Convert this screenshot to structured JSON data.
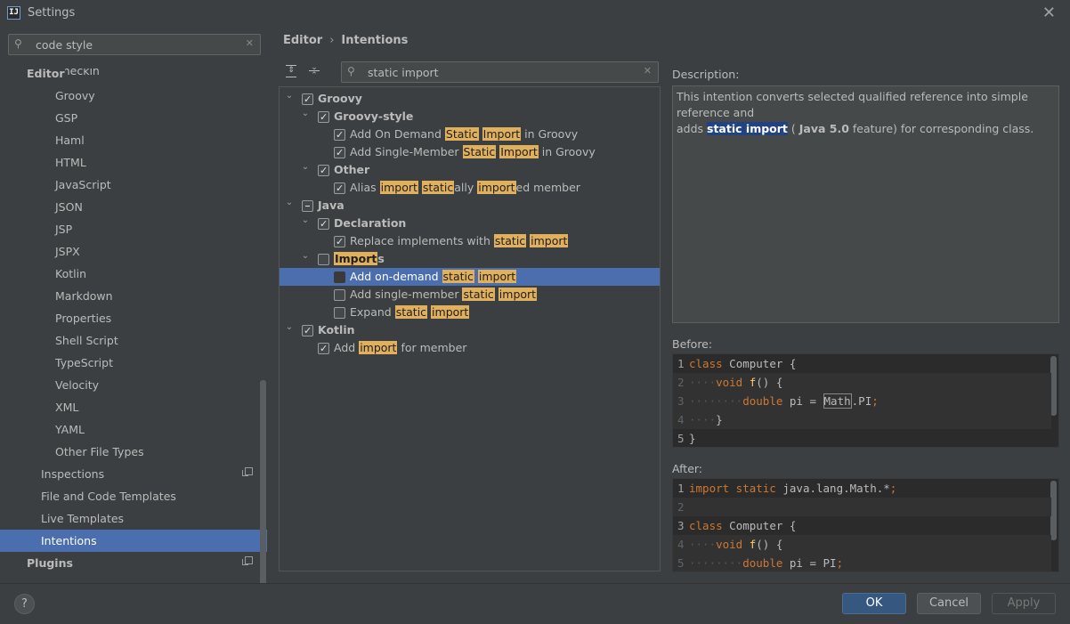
{
  "window": {
    "title": "Settings",
    "icon": "intellij-icon",
    "icon_text": "IJ"
  },
  "sidebar": {
    "search_value": "code style",
    "items": [
      {
        "label": "Editor",
        "bold": true,
        "level": 0
      },
      {
        "label": "Checkin",
        "level": 2,
        "partial": true
      },
      {
        "label": "Groovy",
        "level": 2
      },
      {
        "label": "GSP",
        "level": 2
      },
      {
        "label": "Haml",
        "level": 2
      },
      {
        "label": "HTML",
        "level": 2
      },
      {
        "label": "JavaScript",
        "level": 2
      },
      {
        "label": "JSON",
        "level": 2
      },
      {
        "label": "JSP",
        "level": 2
      },
      {
        "label": "JSPX",
        "level": 2
      },
      {
        "label": "Kotlin",
        "level": 2
      },
      {
        "label": "Markdown",
        "level": 2
      },
      {
        "label": "Properties",
        "level": 2
      },
      {
        "label": "Shell Script",
        "level": 2
      },
      {
        "label": "TypeScript",
        "level": 2
      },
      {
        "label": "Velocity",
        "level": 2
      },
      {
        "label": "XML",
        "level": 2
      },
      {
        "label": "YAML",
        "level": 2
      },
      {
        "label": "Other File Types",
        "level": 2
      },
      {
        "label": "Inspections",
        "level": 1,
        "copy_icon": true
      },
      {
        "label": "File and Code Templates",
        "level": 1
      },
      {
        "label": "Live Templates",
        "level": 1
      },
      {
        "label": "Intentions",
        "level": 1,
        "selected": true
      },
      {
        "label": "Plugins",
        "bold": true,
        "level": 0,
        "copy_icon": true
      }
    ]
  },
  "breadcrumb": {
    "parent": "Editor",
    "separator": "›",
    "current": "Intentions"
  },
  "toolbar": {
    "expand_all": "expand-all-icon",
    "collapse_all": "collapse-all-icon"
  },
  "intentions_search": {
    "value": "static import"
  },
  "tree": [
    {
      "level": 0,
      "arrow": "v",
      "check": "on",
      "bold": true,
      "segments": [
        {
          "t": "Groovy"
        }
      ]
    },
    {
      "level": 1,
      "arrow": "v",
      "check": "on",
      "bold": true,
      "segments": [
        {
          "t": "Groovy-style"
        }
      ]
    },
    {
      "level": 2,
      "check": "on",
      "segments": [
        {
          "t": "Add On Demand "
        },
        {
          "t": "Static",
          "h": true
        },
        {
          "t": " "
        },
        {
          "t": "Import",
          "h": true
        },
        {
          "t": " in Groovy"
        }
      ]
    },
    {
      "level": 2,
      "check": "on",
      "segments": [
        {
          "t": "Add Single-Member "
        },
        {
          "t": "Static",
          "h": true
        },
        {
          "t": " "
        },
        {
          "t": "Import",
          "h": true
        },
        {
          "t": " in Groovy"
        }
      ]
    },
    {
      "level": 1,
      "arrow": "v",
      "check": "on",
      "bold": true,
      "segments": [
        {
          "t": "Other"
        }
      ]
    },
    {
      "level": 2,
      "check": "on",
      "segments": [
        {
          "t": "Alias "
        },
        {
          "t": "import",
          "h": true
        },
        {
          "t": " "
        },
        {
          "t": "static",
          "h": true
        },
        {
          "t": "ally "
        },
        {
          "t": "import",
          "h": true
        },
        {
          "t": "ed member"
        }
      ]
    },
    {
      "level": 0,
      "arrow": "v",
      "check": "part",
      "bold": true,
      "segments": [
        {
          "t": "Java"
        }
      ]
    },
    {
      "level": 1,
      "arrow": "v",
      "check": "on",
      "bold": true,
      "segments": [
        {
          "t": "Declaration"
        }
      ]
    },
    {
      "level": 2,
      "check": "on",
      "segments": [
        {
          "t": "Replace implements with "
        },
        {
          "t": "static",
          "h": true
        },
        {
          "t": " "
        },
        {
          "t": "import",
          "h": true
        }
      ]
    },
    {
      "level": 1,
      "arrow": "v",
      "check": "off",
      "bold": true,
      "segments": [
        {
          "t": "Import",
          "h": true
        },
        {
          "t": "s"
        }
      ]
    },
    {
      "level": 2,
      "check": "off",
      "selected": true,
      "segments": [
        {
          "t": "Add on-demand "
        },
        {
          "t": "static",
          "h": true
        },
        {
          "t": " "
        },
        {
          "t": "import",
          "h": true
        }
      ]
    },
    {
      "level": 2,
      "check": "off",
      "segments": [
        {
          "t": "Add single-member "
        },
        {
          "t": "static",
          "h": true
        },
        {
          "t": " "
        },
        {
          "t": "import",
          "h": true
        }
      ]
    },
    {
      "level": 2,
      "check": "off",
      "segments": [
        {
          "t": "Expand "
        },
        {
          "t": "static",
          "h": true
        },
        {
          "t": " "
        },
        {
          "t": "import",
          "h": true
        }
      ]
    },
    {
      "level": 0,
      "arrow": "v",
      "check": "on",
      "bold": true,
      "segments": [
        {
          "t": "Kotlin"
        }
      ]
    },
    {
      "level": 1,
      "check": "on",
      "segments": [
        {
          "t": "Add "
        },
        {
          "t": "import",
          "h": true
        },
        {
          "t": " for member"
        }
      ]
    }
  ],
  "description": {
    "label": "Description:",
    "line1": "This intention converts selected qualified reference into simple reference and",
    "adds": "adds ",
    "hl_static": "static",
    "hl_import": "import",
    "paren_open": " ( ",
    "java": "Java 5.0",
    "rest": " feature) for corresponding class."
  },
  "before": {
    "label": "Before:",
    "lines": [
      {
        "n": "1",
        "active": true,
        "tokens": [
          {
            "c": "kw",
            "t": "class"
          },
          {
            "c": "idt",
            "t": " Computer {"
          }
        ]
      },
      {
        "n": "2",
        "tokens": [
          {
            "c": "dot",
            "t": "····"
          },
          {
            "c": "kw",
            "t": "void"
          },
          {
            "c": "fn",
            "t": " f"
          },
          {
            "c": "idt",
            "t": "() {"
          }
        ]
      },
      {
        "n": "3",
        "tokens": [
          {
            "c": "dot",
            "t": "········"
          },
          {
            "c": "kw",
            "t": "double"
          },
          {
            "c": "idt",
            "t": " pi = "
          },
          {
            "c": "boxed",
            "t": "Math"
          },
          {
            "c": "idt",
            "t": ".PI"
          },
          {
            "c": "kw",
            "t": ";"
          }
        ]
      },
      {
        "n": "4",
        "tokens": [
          {
            "c": "dot",
            "t": "····"
          },
          {
            "c": "idt",
            "t": "}"
          }
        ]
      },
      {
        "n": "5",
        "active": true,
        "tokens": [
          {
            "c": "idt",
            "t": "}"
          }
        ]
      }
    ]
  },
  "after": {
    "label": "After:",
    "lines": [
      {
        "n": "1",
        "active": true,
        "tokens": [
          {
            "c": "kw",
            "t": "import static"
          },
          {
            "c": "idt",
            "t": " java.lang.Math.*"
          },
          {
            "c": "kw",
            "t": ";"
          }
        ]
      },
      {
        "n": "2",
        "tokens": []
      },
      {
        "n": "3",
        "active": true,
        "tokens": [
          {
            "c": "kw",
            "t": "class"
          },
          {
            "c": "idt",
            "t": " Computer {"
          }
        ]
      },
      {
        "n": "4",
        "tokens": [
          {
            "c": "dot",
            "t": "····"
          },
          {
            "c": "kw",
            "t": "void"
          },
          {
            "c": "fn",
            "t": " f"
          },
          {
            "c": "idt",
            "t": "() {"
          }
        ]
      },
      {
        "n": "5",
        "tokens": [
          {
            "c": "dot",
            "t": "········"
          },
          {
            "c": "kw",
            "t": "double"
          },
          {
            "c": "idt",
            "t": " pi = PI"
          },
          {
            "c": "kw",
            "t": ";"
          }
        ]
      }
    ]
  },
  "footer": {
    "help": "?",
    "ok": "OK",
    "cancel": "Cancel",
    "apply": "Apply"
  },
  "colors": {
    "selection": "#4b6eaf",
    "highlight": "#e0b05c",
    "primary_button": "#365880",
    "keyword": "#cc7832",
    "function": "#ffc66d"
  }
}
